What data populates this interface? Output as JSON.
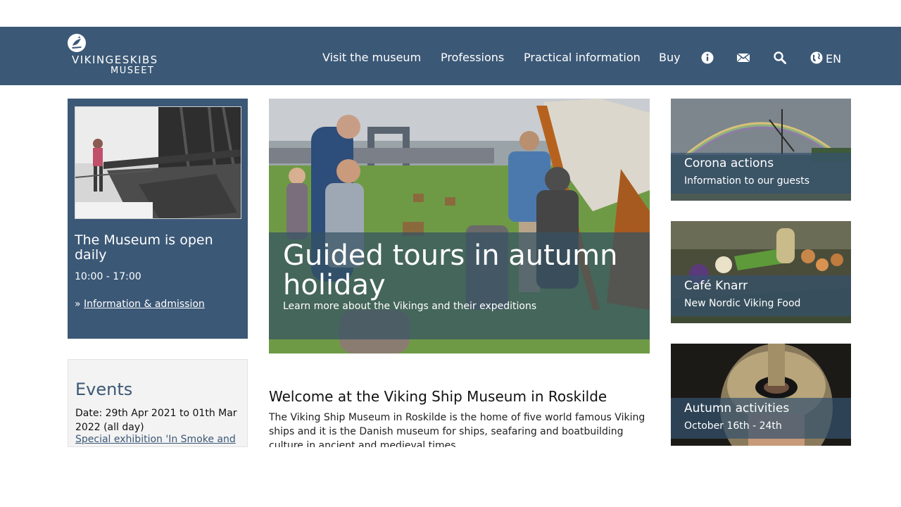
{
  "header": {
    "logo": {
      "line1": "VIKINGESKIBS",
      "line2": "MUSEET"
    },
    "nav": [
      {
        "label": "Visit the museum"
      },
      {
        "label": "Professions"
      },
      {
        "label": "Practical information"
      },
      {
        "label": "Buy"
      }
    ],
    "icons": [
      "info-icon",
      "mail-icon",
      "search-icon",
      "globe-icon"
    ],
    "language": "EN"
  },
  "opening": {
    "title": "The Museum is open daily",
    "hours": "10:00 - 17:00",
    "link_prefix": "»",
    "link_label": "Information & admission"
  },
  "events": {
    "title": "Events",
    "date": "Date: 29th Apr 2021 to 01th Mar 2022 (all day)",
    "link_label": "Special exhibition 'In Smoke and"
  },
  "hero": {
    "title": "Guided tours in autumn holiday",
    "subtitle": "Learn more about the Vikings and their expeditions"
  },
  "welcome": {
    "title": "Welcome at the Viking Ship Museum in Roskilde",
    "text": "The Viking Ship Museum in Roskilde is the home of five world famous Viking ships and it is the Danish museum for ships, seafaring and boatbuilding culture in ancient and medieval times."
  },
  "cards": [
    {
      "title": "Corona actions",
      "subtitle": "Information to our guests"
    },
    {
      "title": "Café Knarr",
      "subtitle": "New Nordic Viking Food"
    },
    {
      "title": "Autumn activities",
      "subtitle": "October 16th - 24th"
    }
  ],
  "colors": {
    "brand": "#3b5876",
    "events_bg": "#f3f3f3",
    "text_dark": "#111111"
  }
}
